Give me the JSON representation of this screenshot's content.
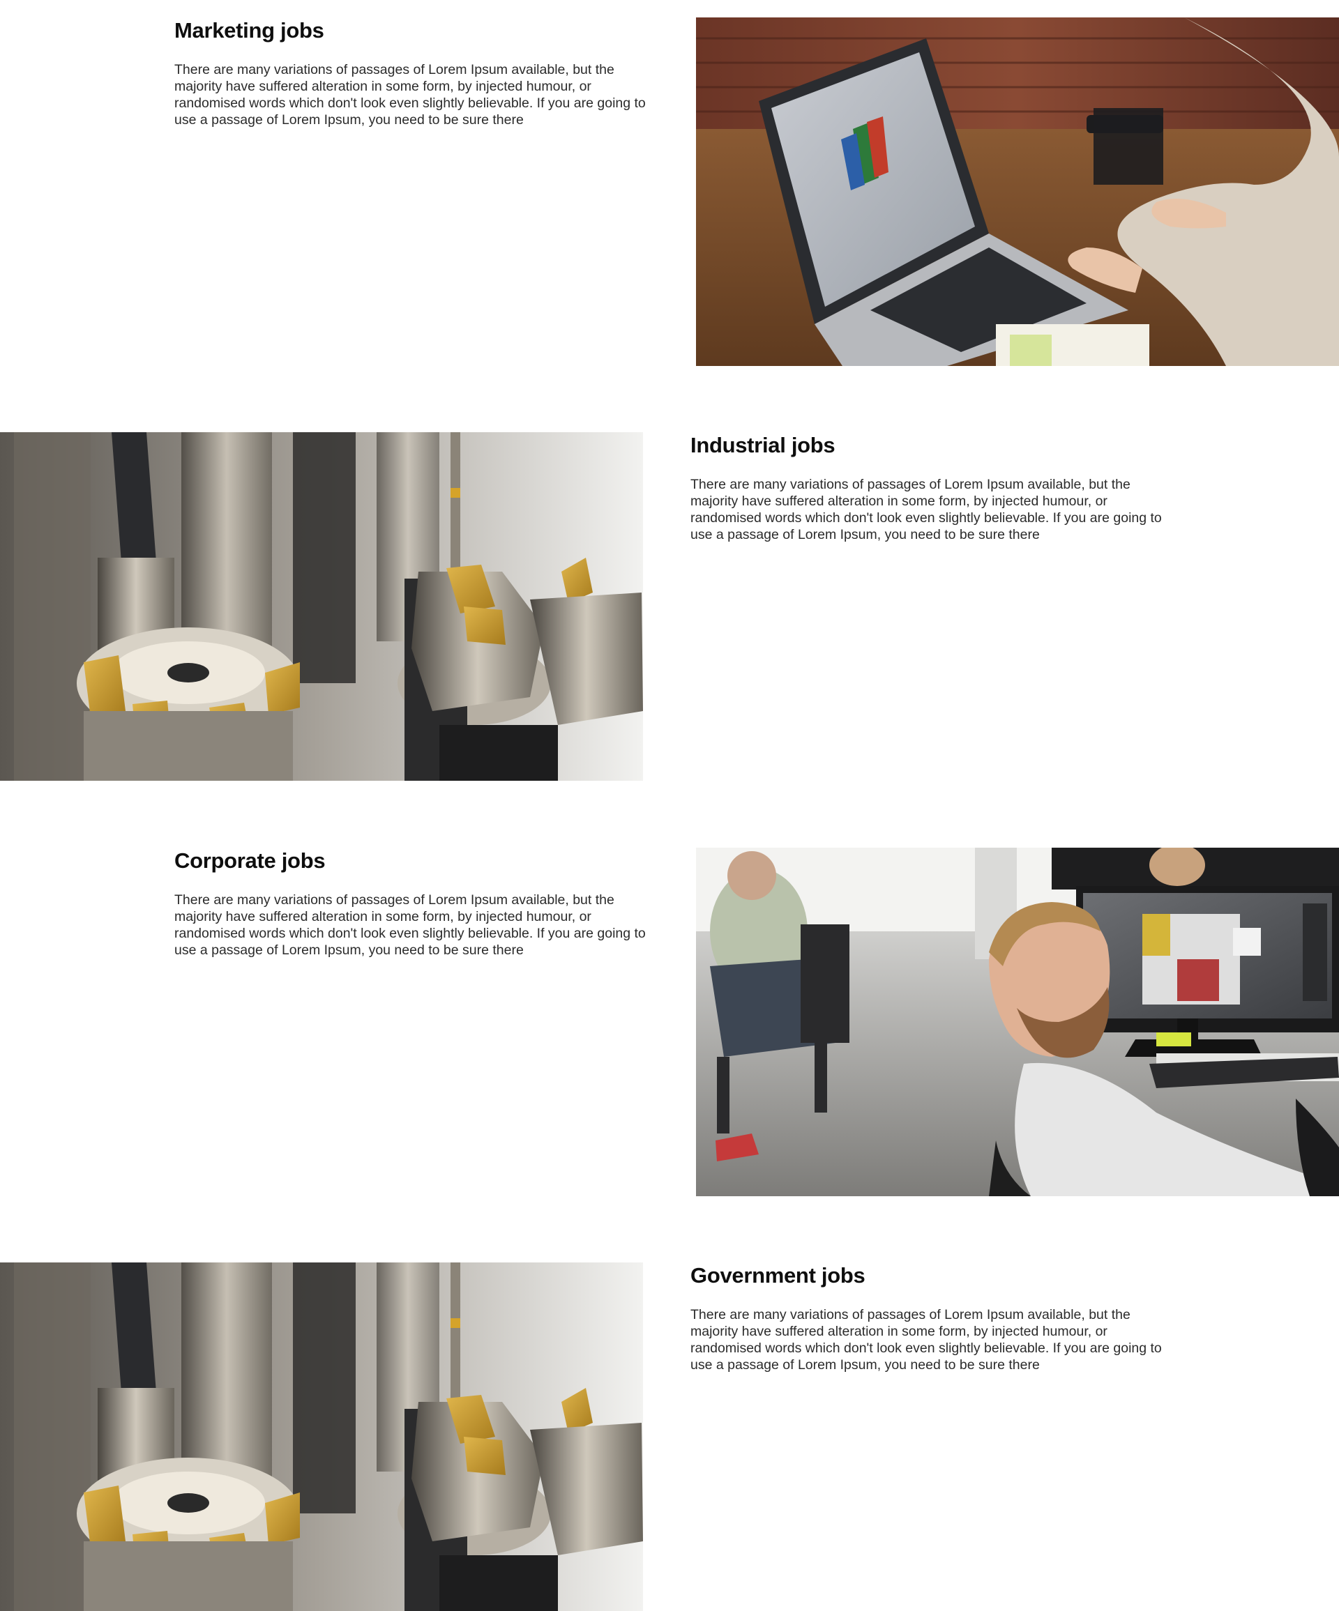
{
  "sections": [
    {
      "heading": "Marketing jobs",
      "body": "There are many variations of passages of Lorem Ipsum available, but the majority have suffered alteration in some form, by injected humour, or randomised words which don't look even slightly believable. If you are going to use a passage of Lorem Ipsum, you need to be sure there",
      "image": "laptop-photo",
      "image_side": "right"
    },
    {
      "heading": "Industrial jobs",
      "body": "There are many variations of passages of Lorem Ipsum available, but the majority have suffered alteration in some form, by injected humour, or randomised words which don't look even slightly believable. If you are going to use a passage of Lorem Ipsum, you need to be sure there",
      "image": "milling-tools-photo",
      "image_side": "left"
    },
    {
      "heading": "Corporate jobs",
      "body": "There are many variations of passages of Lorem Ipsum available, but the majority have suffered alteration in some form, by injected humour, or randomised words which don't look even slightly believable. If you are going to use a passage of Lorem Ipsum, you need to be sure there",
      "image": "office-worker-photo",
      "image_side": "right"
    },
    {
      "heading": "Government jobs",
      "body": "There are many variations of passages of Lorem Ipsum available, but the majority have suffered alteration in some form, by injected humour, or randomised words which don't look even slightly believable. If you are going to use a passage of Lorem Ipsum, you need to be sure there",
      "image": "milling-tools-photo",
      "image_side": "left"
    }
  ]
}
